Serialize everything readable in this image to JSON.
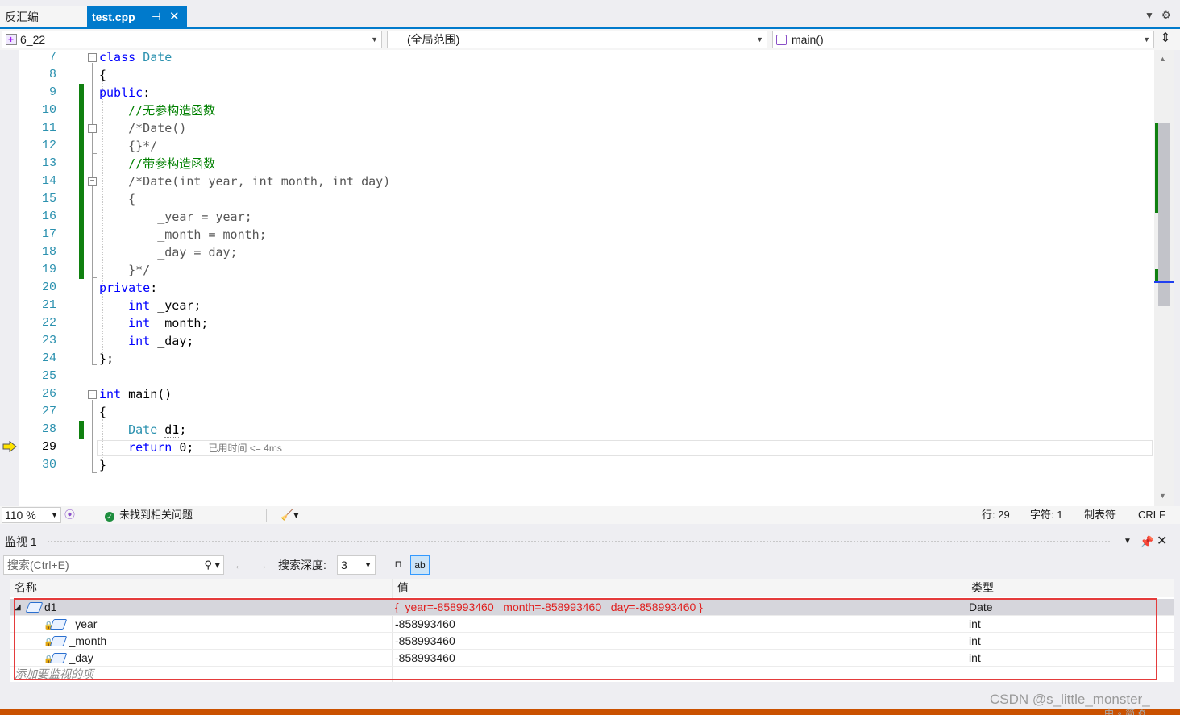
{
  "tabs": {
    "disasm_label": "反汇编",
    "active_label": "test.cpp",
    "pin_glyph": "⊣",
    "close_glyph": "✕"
  },
  "nav": {
    "project": "6_22",
    "scope": "(全局范围)",
    "member": "main()"
  },
  "editor": {
    "lines": [
      {
        "num": "7",
        "segments": [
          [
            "kw",
            "class "
          ],
          [
            "ty",
            "Date"
          ]
        ]
      },
      {
        "num": "8",
        "segments": [
          [
            "",
            "{"
          ]
        ]
      },
      {
        "num": "9",
        "segments": [
          [
            "kw",
            "public"
          ],
          [
            "",
            ":"
          ]
        ]
      },
      {
        "num": "10",
        "segments": [
          [
            "",
            "    "
          ],
          [
            "cm",
            "//无参构造函数"
          ]
        ]
      },
      {
        "num": "11",
        "segments": [
          [
            "",
            "    "
          ],
          [
            "cm2",
            "/*Date()"
          ]
        ]
      },
      {
        "num": "12",
        "segments": [
          [
            "",
            "    "
          ],
          [
            "cm2",
            "{}*/"
          ]
        ]
      },
      {
        "num": "13",
        "segments": [
          [
            "",
            "    "
          ],
          [
            "cm",
            "//带参构造函数"
          ]
        ]
      },
      {
        "num": "14",
        "segments": [
          [
            "",
            "    "
          ],
          [
            "cm2",
            "/*Date(int year, int month, int day)"
          ]
        ]
      },
      {
        "num": "15",
        "segments": [
          [
            "",
            "    "
          ],
          [
            "cm2",
            "{"
          ]
        ]
      },
      {
        "num": "16",
        "segments": [
          [
            "",
            "        "
          ],
          [
            "cm2",
            "_year = year;"
          ]
        ]
      },
      {
        "num": "17",
        "segments": [
          [
            "",
            "        "
          ],
          [
            "cm2",
            "_month = month;"
          ]
        ]
      },
      {
        "num": "18",
        "segments": [
          [
            "",
            "        "
          ],
          [
            "cm2",
            "_day = day;"
          ]
        ]
      },
      {
        "num": "19",
        "segments": [
          [
            "",
            "    "
          ],
          [
            "cm2",
            "}*/"
          ]
        ]
      },
      {
        "num": "20",
        "segments": [
          [
            "kw",
            "private"
          ],
          [
            "",
            ":"
          ]
        ]
      },
      {
        "num": "21",
        "segments": [
          [
            "",
            "    "
          ],
          [
            "kw",
            "int"
          ],
          [
            "",
            " _year;"
          ]
        ]
      },
      {
        "num": "22",
        "segments": [
          [
            "",
            "    "
          ],
          [
            "kw",
            "int"
          ],
          [
            "",
            " _month;"
          ]
        ]
      },
      {
        "num": "23",
        "segments": [
          [
            "",
            "    "
          ],
          [
            "kw",
            "int"
          ],
          [
            "",
            " _day;"
          ]
        ]
      },
      {
        "num": "24",
        "segments": [
          [
            "",
            "};"
          ]
        ]
      },
      {
        "num": "25",
        "segments": []
      },
      {
        "num": "26",
        "segments": [
          [
            "kw",
            "int"
          ],
          [
            "",
            " main()"
          ]
        ]
      },
      {
        "num": "27",
        "segments": [
          [
            "",
            "{"
          ]
        ]
      },
      {
        "num": "28",
        "segments": [
          [
            "",
            "    "
          ],
          [
            "ty",
            "Date"
          ],
          [
            "",
            " "
          ],
          [
            "sq",
            "d1"
          ],
          [
            "",
            ";"
          ]
        ]
      },
      {
        "num": "29",
        "segments": [
          [
            "",
            "    "
          ],
          [
            "kw",
            "return"
          ],
          [
            "",
            " 0;  "
          ],
          [
            "tip",
            "已用时间 <= 4ms"
          ]
        ]
      },
      {
        "num": "30",
        "segments": [
          [
            "",
            "}"
          ]
        ]
      }
    ]
  },
  "status": {
    "zoom": "110 %",
    "issues": "未找到相关问题",
    "line": "行: 29",
    "char": "字符: 1",
    "tabs": "制表符",
    "eol": "CRLF"
  },
  "watch": {
    "title": "监视 1",
    "search_placeholder": "搜索(Ctrl+E)",
    "depth_label": "搜索深度:",
    "depth_value": "3",
    "columns": {
      "name": "名称",
      "value": "值",
      "type": "类型"
    },
    "rows": [
      {
        "name": "d1",
        "value": "{_year=-858993460 _month=-858993460 _day=-858993460 }",
        "type": "Date"
      },
      {
        "name": "_year",
        "value": "-858993460",
        "type": "int"
      },
      {
        "name": "_month",
        "value": "-858993460",
        "type": "int"
      },
      {
        "name": "_day",
        "value": "-858993460",
        "type": "int"
      }
    ],
    "add_item": "添加要监视的项"
  },
  "watermark": "CSDN @s_little_monster_",
  "watermark_under": "中 ∘ 简 ⚙",
  "colors": {
    "accent": "#007acc",
    "changed_value": "#e0201f",
    "highlight_border": "#e43b3b",
    "change_bar": "#108010"
  }
}
